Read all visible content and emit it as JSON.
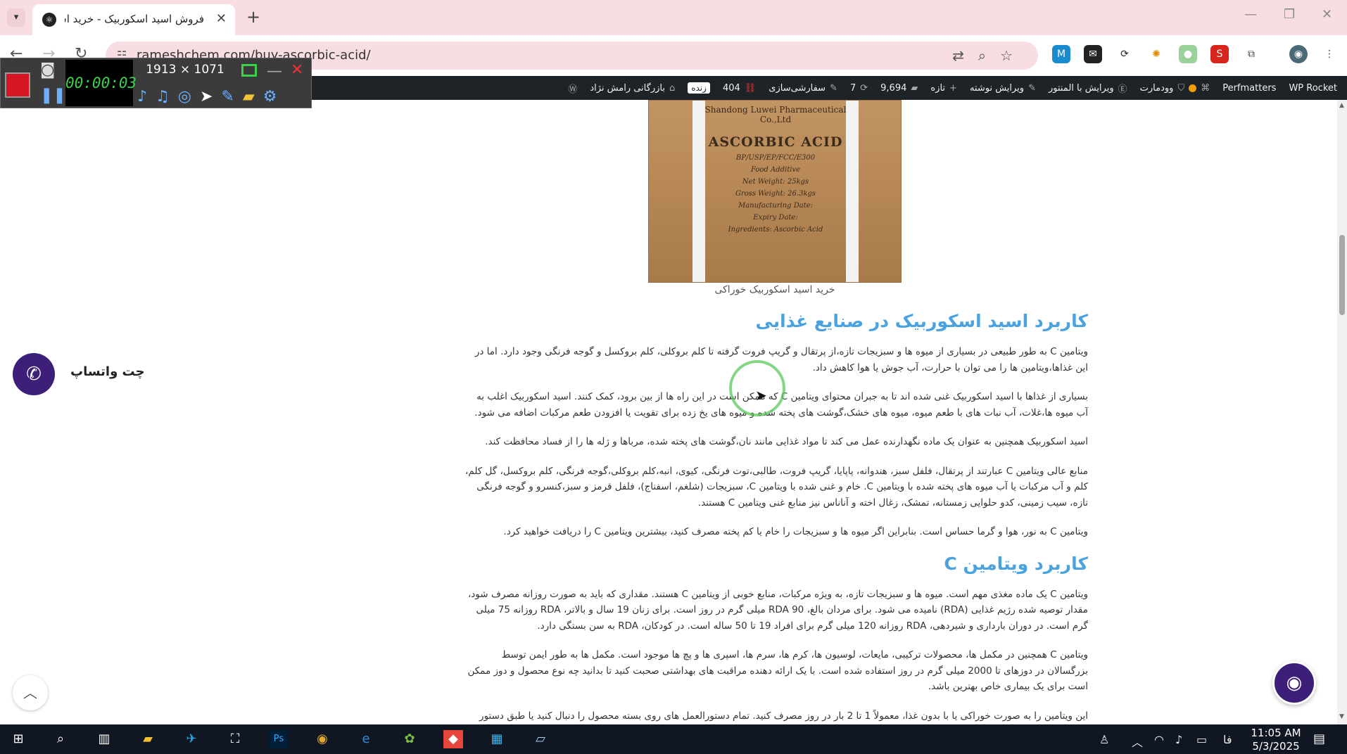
{
  "browser": {
    "tab_title": "فروش اسید اسکوربیک - خرید اسید",
    "url": "rameshchem.com/buy-ascorbic-acid/"
  },
  "recorder": {
    "timer": "00:00:03",
    "size": "1913 × 1071"
  },
  "adminbar": {
    "site_name": "بازرگانی رامش نژاد",
    "live_badge": "زنده",
    "errors_count": "404",
    "customize": "سفارشی‌سازی",
    "updates_count": "7",
    "comments_count": "9,694",
    "new": "تازه",
    "edit_post": "ویرایش نوشته",
    "edit_elementor": "ویرایش با المنتور",
    "woodmart": "وودمارت",
    "perfmatters": "Perfmatters",
    "wp_rocket": "WP Rocket"
  },
  "product_image": {
    "maker": "Shandong Luwei Pharmaceutical Co.,Ltd",
    "title": "ASCORBIC ACID",
    "lines": [
      "BP/USP/EP/FCC/E300",
      "Food Additive",
      "Net Weight: 25kgs",
      "Gross Weight: 26.3kgs",
      "Manufacturing Date:",
      "Expiry Date:",
      "Ingredients: Ascorbic Acid"
    ],
    "caption": "خرید اسید اسکوربیک خوراکی"
  },
  "article": {
    "h1": "کاربرد اسید اسکوربیک در صنایع غذایی",
    "p1": "ویتامین C به طور طبیعی در بسیاری از میوه ها و سبزیجات تازه،از پرتقال و گریپ فروت گرفته تا کلم بروکلی، کلم بروکسل و گوجه فرنگی وجود دارد. اما در این غذاها،ویتامین ها را می توان با حرارت، آب جوش یا هوا کاهش داد.",
    "p2": "بسیاری از غذاها با اسید اسکوربیک غنی شده اند تا به جبران محتوای ویتامین C که ممکن است در این راه ها از بین برود، کمک کنند. اسید اسکوربیک اغلب به آب میوه ها،غلات، آب نبات های با طعم میوه، میوه های خشک،گوشت های پخته شده و میوه های یخ زده برای تقویت یا افزودن طعم مرکبات اضافه می شود.",
    "p3": "اسید اسکوربیک همچنین به عنوان یک ماده نگهدارنده عمل می کند تا مواد غذایی مانند نان،گوشت های پخته شده، مرباها و ژله ها را از فساد محافظت کند.",
    "p4": "منابع عالی ویتامین C عبارتند از پرتقال، فلفل سبز، هندوانه، پاپایا، گریپ فروت، طالبی،توت فرنگی، کیوی، انبه،کلم بروکلی،گوجه فرنگی، کلم بروکسل، گل کلم، کلم و آب مرکبات یا آب میوه های پخته شده با ویتامین C. خام و غنی شده با ویتامین C، سبزیجات (شلغم، اسفناج)، فلفل قرمز و سبز،کنسرو و گوجه فرنگی تازه، سیب زمینی، کدو حلوایی زمستانه، تمشک، زغال اخته و آناناس نیز منابع غنی ویتامین C هستند.",
    "p5": "ویتامین C به نور، هوا و گرما حساس است. بنابراین اگر میوه ها و سبزیجات را خام یا کم پخته مصرف کنید، بیشترین ویتامین C را دریافت خواهید کرد.",
    "h2": "کاربرد ویتامین C",
    "p6": "ویتامین C یک ماده مغذی مهم است. میوه ها و سبزیجات تازه، به ویژه مرکبات، منابع خوبی از ویتامین C هستند. مقداری که باید به صورت روزانه مصرف شود، مقدار توصیه شده رژیم غذایی (RDA) نامیده می شود. برای مردان بالغ، RDA 90 میلی گرم در روز است. برای زنان 19 سال و بالاتر، RDA روزانه 75 میلی گرم است. در دوران بارداری و شیردهی، RDA روزانه 120 میلی گرم برای افراد 19 تا 50 ساله است. در کودکان، RDA به سن بستگی دارد.",
    "p7": "ویتامین C همچنین در مکمل ها، محصولات ترکیبی، مایعات، لوسیون ها، کرم ها، سرم ها، اسپری ها و پچ ها موجود است. مکمل ها به طور ایمن توسط بزرگسالان در دوزهای تا 2000 میلی گرم در روز استفاده شده است. با یک ارائه دهنده مراقبت های بهداشتی صحبت کنید تا بدانید چه نوع محصول و دوز ممکن است برای یک بیماری خاص بهترین باشد.",
    "p8": "این ویتامین را به صورت خوراکی یا با بدون غذا، معمولاً 1 تا 2 بار در روز مصرف کنید. تمام دستورالعمل های روی بسته محصول را دنبال کنید یا طبق دستور پزشک"
  },
  "widgets": {
    "whatsapp_label": "چت واتساپ"
  },
  "taskbar": {
    "lang": "فا",
    "time": "11:05 AM",
    "date": "5/3/2025"
  },
  "colors": {
    "heading": "#4aa3df",
    "adminbar": "#1d2327",
    "tabstrip": "#f8dde3",
    "whatsapp": "#3d1f7a"
  }
}
